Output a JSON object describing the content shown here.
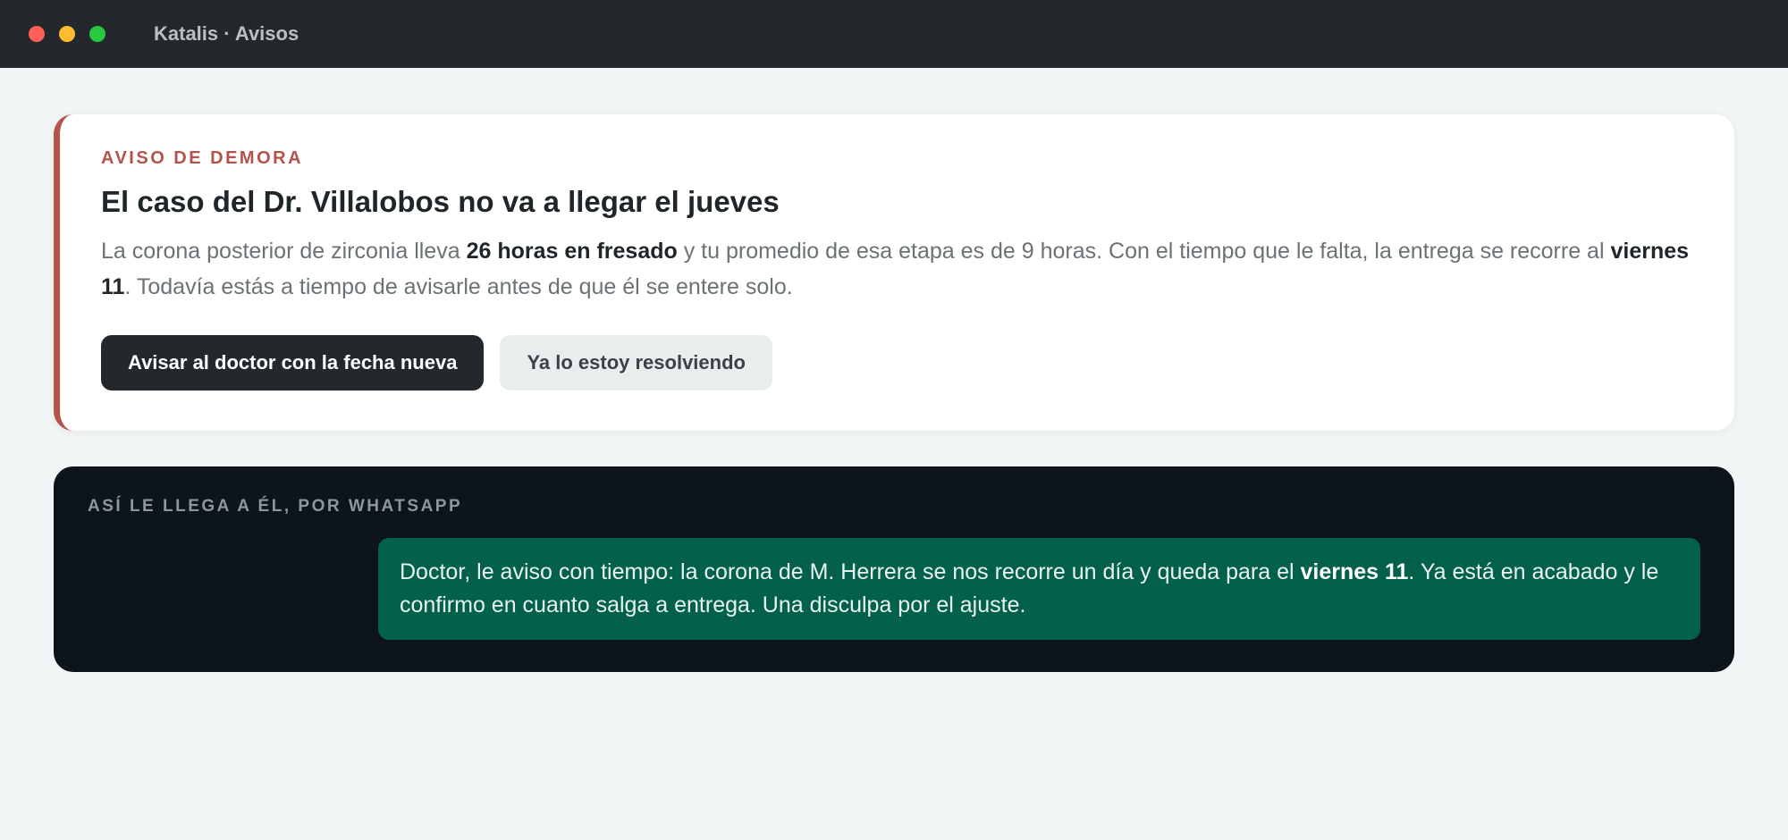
{
  "window": {
    "title": "Katalis · Avisos"
  },
  "alert": {
    "kicker": "AVISO DE DEMORA",
    "title": "El caso del Dr. Villalobos no va a llegar el jueves",
    "body": {
      "p1": "La corona posterior de zirconia lleva ",
      "b1": "26 horas en fresado",
      "p2": " y tu promedio de esa etapa es de 9 horas. Con el tiempo que le falta, la entrega se recorre al ",
      "b2": "viernes 11",
      "p3": ". Todavía estás a tiempo de avisarle antes de que él se entere solo."
    },
    "primary_label": "Avisar al doctor con la fecha nueva",
    "secondary_label": "Ya lo estoy resolviendo"
  },
  "preview": {
    "kicker": "ASÍ LE LLEGA A ÉL, POR WHATSAPP",
    "message": {
      "p1": "Doctor, le aviso con tiempo: la corona de M. Herrera se nos recorre un día y queda para el ",
      "b1": "viernes 11",
      "p2": ". Ya está en acabado y le confirmo en cuanto salga a entrega. Una disculpa por el ajuste."
    }
  },
  "colors": {
    "titlebar": "#22282c",
    "accent_alert": "#b5534a",
    "bubble": "#03604b",
    "preview_bg": "#0e141b"
  }
}
